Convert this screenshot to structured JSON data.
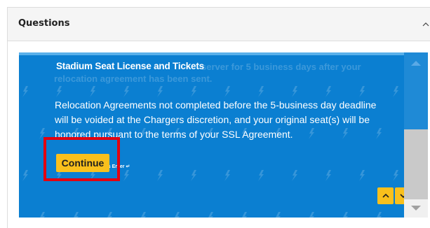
{
  "panel": {
    "title": "Questions",
    "collapse_icon": "chevron-up-icon"
  },
  "slide": {
    "ghost_line1": "server for 5 business days after your",
    "ghost_line2": "relocation agreement has been sent.",
    "title": "Stadium Seat License and Tickets",
    "body_lines": [
      "Relocation Agreements not completed before the 5-business day deadline",
      "will be voided at the Chargers discretion, and your original seat(s) will be",
      "honored pursuant to the terms of your SSL Agreement."
    ],
    "continue_label": "Continue",
    "enter_hint": "ess Enter ↵",
    "prev_icon": "chevron-up-icon",
    "next_icon": "chevron-down-icon"
  },
  "colors": {
    "slide_bg": "#0b7fd1",
    "accent_yellow": "#f9c01c",
    "highlight_red": "#e3000f"
  }
}
